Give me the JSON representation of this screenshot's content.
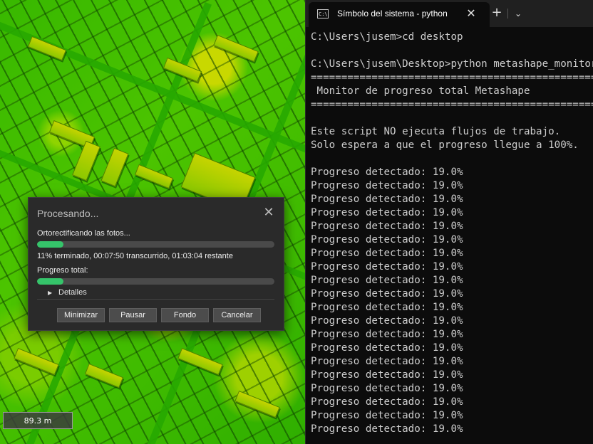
{
  "map": {
    "scale_label": "89.3 m"
  },
  "dialog": {
    "title": "Procesando...",
    "task_label": "Ortorectificando las fotos...",
    "task_progress": 0.11,
    "status_text": "11% terminado, 00:07:50 transcurrido, 01:03:04 restante",
    "total_label": "Progreso total:",
    "total_progress": 0.11,
    "details_label": "Detalles",
    "buttons": {
      "minimize": "Minimizar",
      "pause": "Pausar",
      "background": "Fondo",
      "cancel": "Cancelar"
    }
  },
  "terminal": {
    "tab_title": "Símbolo del sistema - python",
    "icon_glyph": "C:\\",
    "lines": [
      "C:\\Users\\jusem>cd desktop",
      "",
      "C:\\Users\\jusem\\Desktop>python metashape_monitor.py",
      "===================================================",
      " Monitor de progreso total Metashape",
      "===================================================",
      "",
      "Este script NO ejecuta flujos de trabajo.",
      "Solo espera a que el progreso llegue a 100%.",
      "",
      "Progreso detectado: 19.0%",
      "Progreso detectado: 19.0%",
      "Progreso detectado: 19.0%",
      "Progreso detectado: 19.0%",
      "Progreso detectado: 19.0%",
      "Progreso detectado: 19.0%",
      "Progreso detectado: 19.0%",
      "Progreso detectado: 19.0%",
      "Progreso detectado: 19.0%",
      "Progreso detectado: 19.0%",
      "Progreso detectado: 19.0%",
      "Progreso detectado: 19.0%",
      "Progreso detectado: 19.0%",
      "Progreso detectado: 19.0%",
      "Progreso detectado: 19.0%",
      "Progreso detectado: 19.0%",
      "Progreso detectado: 19.0%",
      "Progreso detectado: 19.0%",
      "Progreso detectado: 19.0%",
      "Progreso detectado: 19.0%"
    ]
  }
}
